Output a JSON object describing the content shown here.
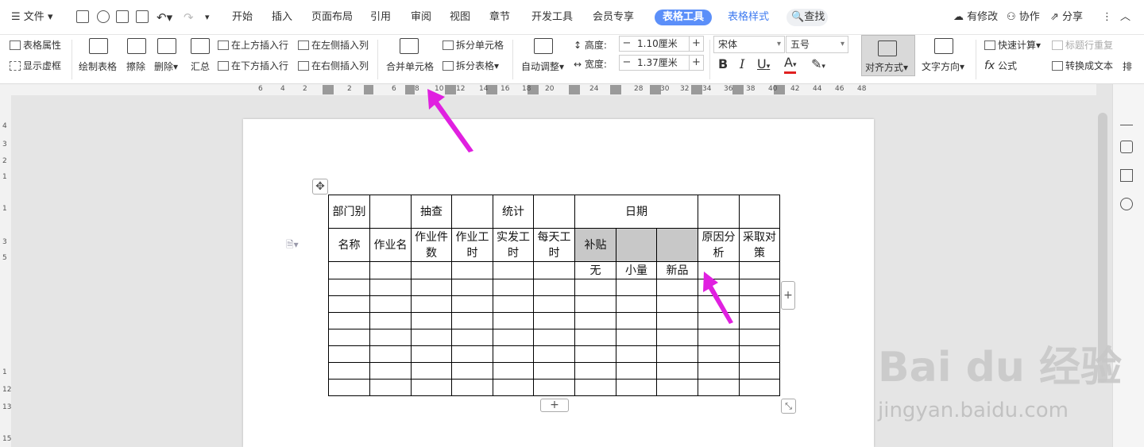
{
  "menu": {
    "file": "文件",
    "tabs": [
      "开始",
      "插入",
      "页面布局",
      "引用",
      "审阅",
      "视图",
      "章节",
      "开发工具",
      "会员专享"
    ],
    "table_tools": "表格工具",
    "table_style": "表格样式",
    "search": "查找",
    "modified": "有修改",
    "collab": "协作",
    "share": "分享"
  },
  "ribbon": {
    "table_props": "表格属性",
    "show_grid": "显示虚框",
    "draw_table": "绘制表格",
    "erase": "擦除",
    "delete": "删除",
    "summary": "汇总",
    "insert_above": "在上方插入行",
    "insert_below": "在下方插入行",
    "insert_left": "在左侧插入列",
    "insert_right": "在右侧插入列",
    "merge_cells": "合并单元格",
    "split_cells": "拆分单元格",
    "split_table": "拆分表格",
    "auto_adjust": "自动调整",
    "height_label": "高度:",
    "height_value": "1.10厘米",
    "width_label": "宽度:",
    "width_value": "1.37厘米",
    "font": "宋体",
    "font_size": "五号",
    "align": "对齐方式",
    "text_direction": "文字方向",
    "quick_calc": "快速计算",
    "repeat_header": "标题行重复",
    "formula": "公式",
    "to_text": "转换成文本",
    "sort": "排"
  },
  "ruler": {
    "h": [
      "6",
      "4",
      "2",
      "2",
      "6",
      "8",
      "10",
      "12",
      "14",
      "16",
      "18",
      "20",
      "24",
      "28",
      "30",
      "32",
      "34",
      "36",
      "38",
      "40",
      "42",
      "44",
      "46",
      "48"
    ],
    "v": [
      "4",
      "3",
      "2",
      "1",
      "1",
      "3",
      "5",
      "1",
      "12",
      "13",
      "15"
    ]
  },
  "table": {
    "r1": [
      "部门别",
      "",
      "抽查",
      "",
      "统计",
      "",
      "日期",
      "",
      ""
    ],
    "r2": [
      "名称",
      "作业名",
      "作业件数",
      "作业工时",
      "实发工时",
      "每天工时",
      "补贴",
      "",
      "",
      "原因分析",
      "采取对策"
    ],
    "r3": [
      "",
      "",
      "",
      "",
      "",
      "",
      "无",
      "小量",
      "新品",
      "",
      ""
    ]
  },
  "watermark": {
    "brand": "Bai du 经验",
    "url": "jingyan.baidu.com"
  },
  "colors": {
    "accent": "#5b8ff9",
    "arrow": "#e020e0",
    "selection": "#c8c8c8"
  }
}
